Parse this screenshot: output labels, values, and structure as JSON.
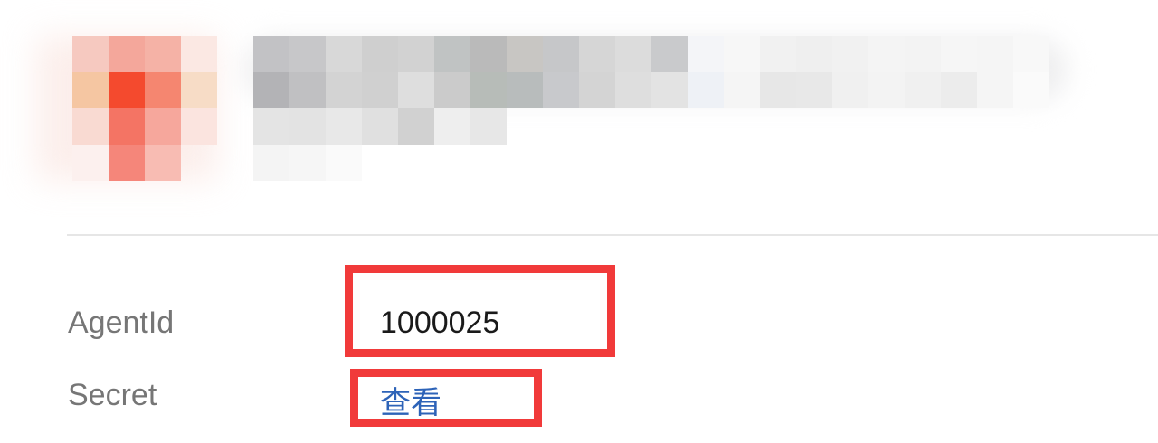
{
  "app": {
    "header": {
      "logo_icon": "app-logo-icon",
      "name_text": "",
      "obscured": true
    },
    "details": {
      "agent_id": {
        "label": "AgentId",
        "value": "1000025"
      },
      "secret": {
        "label": "Secret",
        "link_text": "查看"
      }
    },
    "colors": {
      "highlight": "#f13a3a",
      "link": "#2d63b8",
      "label": "#767676",
      "divider": "#e6e6e6"
    }
  }
}
